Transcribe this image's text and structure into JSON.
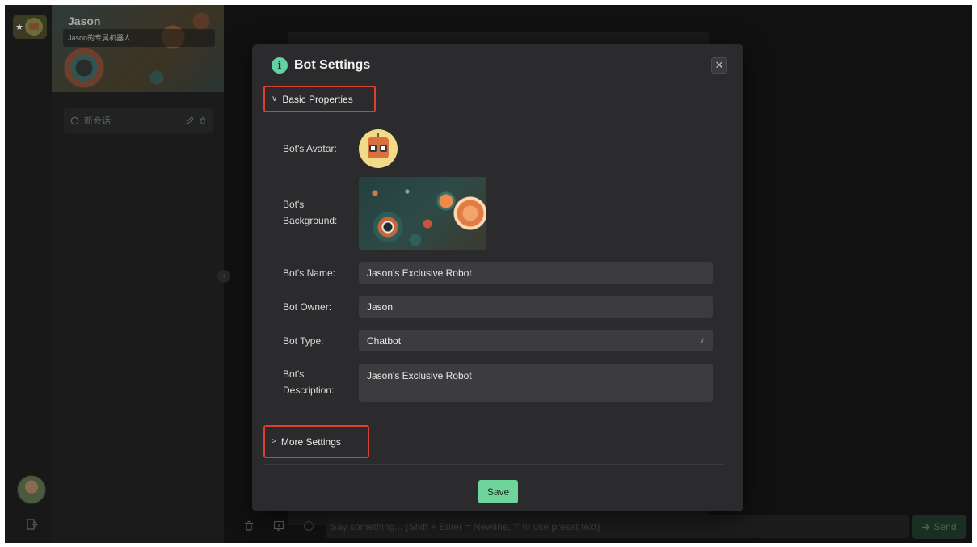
{
  "sidebar": {
    "bot_name": "Jason",
    "bot_subtitle": "Jason的专属机器人",
    "session_label": "新会话"
  },
  "chat": {
    "input_placeholder": "Say something... (Shift + Enter = Newline, '/' to use preset text)",
    "send_label": "Send"
  },
  "modal": {
    "title": "Bot Settings",
    "close_glyph": "✕",
    "basic_section": {
      "label": "Basic Properties",
      "expanded": true
    },
    "fields": {
      "avatar_label": "Bot's Avatar:",
      "background_label": "Bot's Background:",
      "name_label": "Bot's Name:",
      "name_value": "Jason's Exclusive Robot",
      "owner_label": "Bot Owner:",
      "owner_value": "Jason",
      "type_label": "Bot Type:",
      "type_value": "Chatbot",
      "description_label": "Bot's Description:",
      "description_value": "Jason's Exclusive Robot"
    },
    "more_section": {
      "label": "More Settings",
      "expanded": false
    },
    "save_label": "Save"
  },
  "colors": {
    "accent": "#6ed49c",
    "highlight_box": "#d9402e",
    "modal_bg": "#2b2b2d",
    "input_bg": "#3c3c3f",
    "app_bg": "#141414"
  },
  "icons": [
    "star-icon",
    "info-icon",
    "close-icon",
    "chevron-down-icon",
    "chevron-right-icon",
    "chevron-left-icon",
    "caret-down-icon",
    "chat-icon",
    "edit-icon",
    "delete-icon",
    "logout-icon",
    "add-icon",
    "document-icon",
    "help-icon",
    "camera-icon",
    "download-icon",
    "trash-icon",
    "import-icon",
    "send-icon"
  ]
}
